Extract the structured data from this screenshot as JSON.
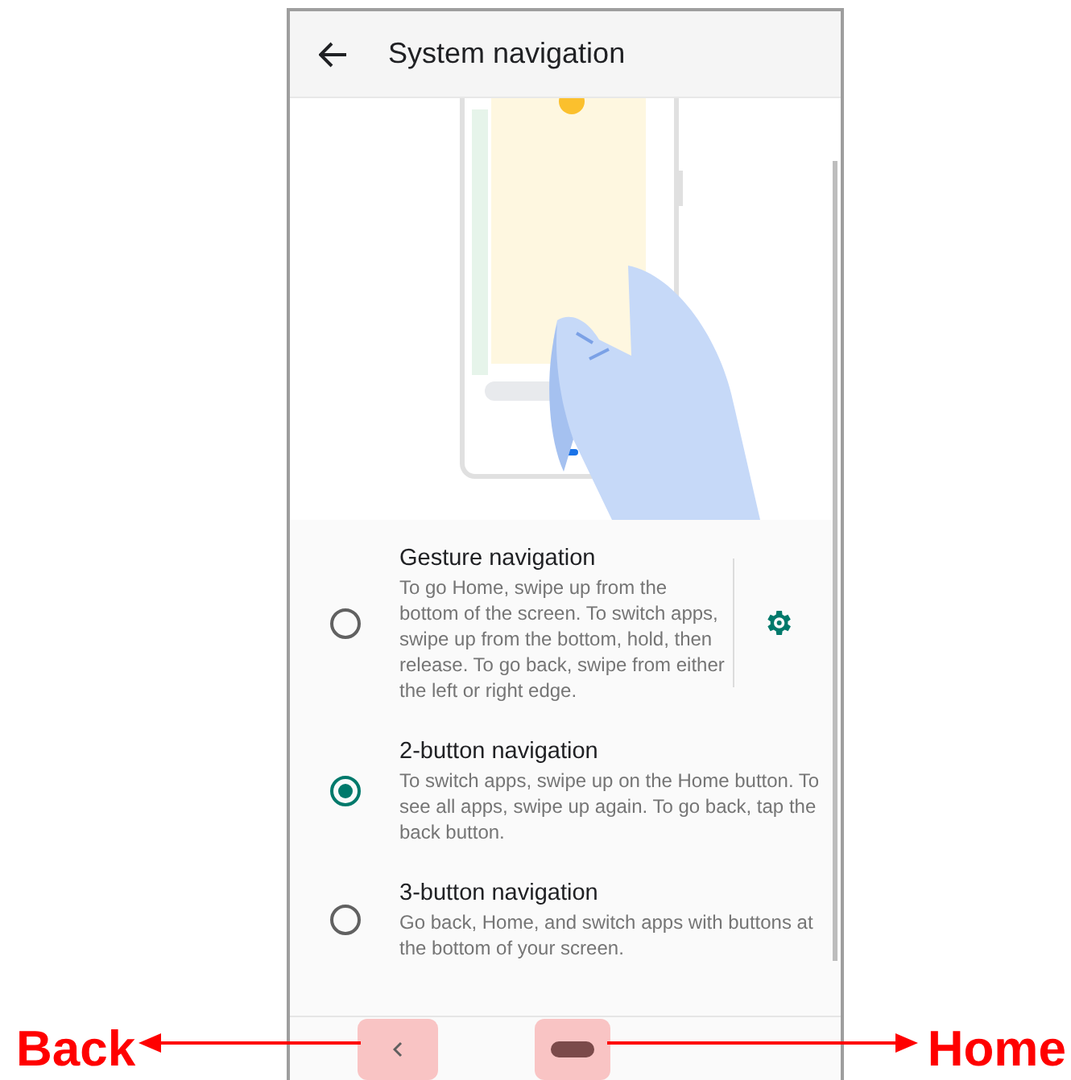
{
  "header": {
    "title": "System navigation"
  },
  "options": [
    {
      "title": "Gesture navigation",
      "description": "To go Home, swipe up from the bottom of the screen. To switch apps, swipe up from the bottom, hold, then release. To go back, swipe from either the left or right edge.",
      "selected": false,
      "settings": true
    },
    {
      "title": "2-button navigation",
      "description": "To switch apps, swipe up on the Home button. To see all apps, swipe up again. To go back, tap the back button.",
      "selected": true,
      "settings": false
    },
    {
      "title": "3-button navigation",
      "description": "Go back, Home, and switch apps with buttons at the bottom of your screen.",
      "selected": false,
      "settings": false
    }
  ],
  "annotations": [
    {
      "kind": "back",
      "label": "Back"
    },
    {
      "kind": "home",
      "label": "Home"
    }
  ]
}
